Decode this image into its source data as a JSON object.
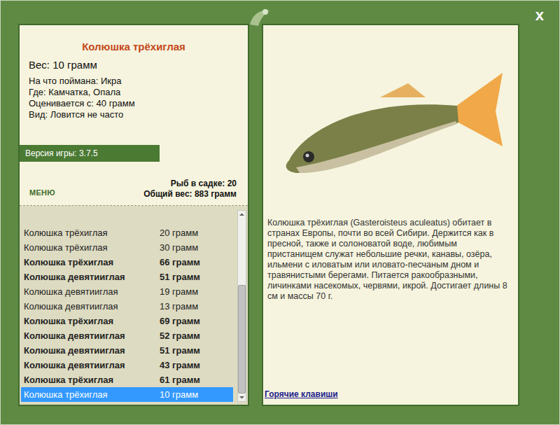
{
  "window": {
    "close": "x"
  },
  "fish": {
    "name": "Колюшка трёхиглая",
    "weight": "Вес: 10 грамм",
    "details": [
      "На что поймана: Икра",
      "Где: Камчатка, Опала",
      "Оценивается с: 40 грамм",
      "Вид: Ловится не часто"
    ]
  },
  "version": "Версия игры: 3.7.5",
  "menu": "МЕНЮ",
  "stats": [
    "Рыб в садке: 20",
    "Общий вес: 883 грамм"
  ],
  "catches": [
    {
      "name": "Колюшка трёхиглая",
      "weight": "20 грамм",
      "highlighted": false,
      "selected": false
    },
    {
      "name": "Колюшка трёхиглая",
      "weight": "30 грамм",
      "highlighted": false,
      "selected": false
    },
    {
      "name": "Колюшка трёхиглая",
      "weight": "66 грамм",
      "highlighted": true,
      "selected": false
    },
    {
      "name": "Колюшка девятииглая",
      "weight": "51 грамм",
      "highlighted": true,
      "selected": false
    },
    {
      "name": "Колюшка девятииглая",
      "weight": "19 грамм",
      "highlighted": false,
      "selected": false
    },
    {
      "name": "Колюшка девятииглая",
      "weight": "13 грамм",
      "highlighted": false,
      "selected": false
    },
    {
      "name": "Колюшка трёхиглая",
      "weight": "69 грамм",
      "highlighted": true,
      "selected": false
    },
    {
      "name": "Колюшка девятииглая",
      "weight": "52 грамм",
      "highlighted": true,
      "selected": false
    },
    {
      "name": "Колюшка девятииглая",
      "weight": "51 грамм",
      "highlighted": true,
      "selected": false
    },
    {
      "name": "Колюшка девятииглая",
      "weight": "43 грамм",
      "highlighted": true,
      "selected": false
    },
    {
      "name": "Колюшка трёхиглая",
      "weight": "61 грамм",
      "highlighted": true,
      "selected": false
    },
    {
      "name": "Колюшка трёхиглая",
      "weight": "10 грамм",
      "highlighted": false,
      "selected": true
    }
  ],
  "scrollbar": {
    "level": 1,
    "thumb": 0.62
  },
  "description": "Колюшка трёхиглая (Gasteroisteus aculeatus) обитает в странах Европы, почти во всей Сибири. Держится как в пресной, также и солоноватой воде, любимым пристанищем служат небольшие речки, канавы, озёра, ильмени с иловатым или иловато-песчаным дном и травянистыми берегами. Питается ракообразными, личинками насекомых, червями, икрой. Достигает длины 8 см и массы 70 г.",
  "hotkeys": "Горячие клавиши"
}
